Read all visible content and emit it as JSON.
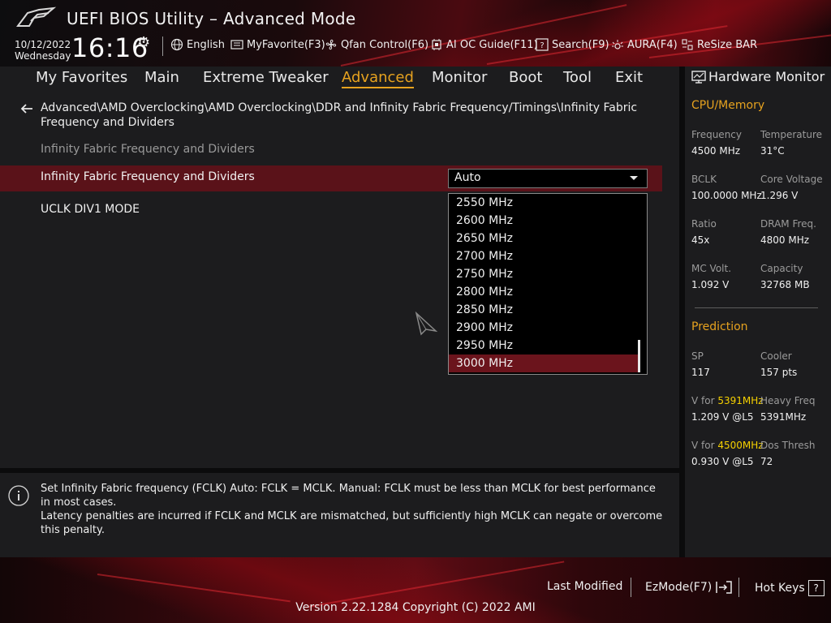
{
  "header": {
    "title": "UEFI BIOS Utility – Advanced Mode",
    "date": "10/12/2022",
    "weekday": "Wednesday",
    "time": "16:16",
    "items": [
      {
        "label": "English",
        "icon": "globe-icon"
      },
      {
        "label": "MyFavorite(F3)",
        "icon": "favorite-list-icon"
      },
      {
        "label": "Qfan Control(F6)",
        "icon": "fan-icon"
      },
      {
        "label": "AI OC Guide(F11)",
        "icon": "chip-icon"
      },
      {
        "label": "Search(F9)",
        "icon": "question-box-icon"
      },
      {
        "label": "AURA(F4)",
        "icon": "aura-light-icon"
      },
      {
        "label": "ReSize BAR",
        "icon": "resize-bar-icon"
      }
    ]
  },
  "nav": {
    "tabs": [
      "My Favorites",
      "Main",
      "Extreme Tweaker",
      "Advanced",
      "Monitor",
      "Boot",
      "Tool",
      "Exit"
    ],
    "active": "Advanced"
  },
  "main": {
    "breadcrumb": "Advanced\\AMD Overclocking\\AMD Overclocking\\DDR and Infinity Fabric Frequency/Timings\\Infinity Fabric Frequency and Dividers",
    "section_title": "Infinity Fabric Frequency and Dividers",
    "rows": [
      {
        "label": "Infinity Fabric Frequency and Dividers",
        "value": "Auto"
      },
      {
        "label": "UCLK DIV1 MODE"
      }
    ],
    "options": [
      "2550 MHz",
      "2600 MHz",
      "2650 MHz",
      "2700 MHz",
      "2750 MHz",
      "2800 MHz",
      "2850 MHz",
      "2900 MHz",
      "2950 MHz",
      "3000 MHz"
    ],
    "selected_option": "3000 MHz"
  },
  "help": {
    "line1": "Set Infinity Fabric frequency (FCLK) Auto: FCLK = MCLK. Manual: FCLK must be less than MCLK for best performance in most cases.",
    "line2": "Latency penalties are incurred if FCLK and MCLK are mismatched, but sufficiently high MCLK can negate or overcome this penalty."
  },
  "hwmon": {
    "title": "Hardware Monitor",
    "cpu_section": "CPU/Memory",
    "cpu": [
      {
        "label": "Frequency",
        "value": "4500 MHz"
      },
      {
        "label": "Temperature",
        "value": "31°C"
      },
      {
        "label": "BCLK",
        "value": "100.0000 MHz"
      },
      {
        "label": "Core Voltage",
        "value": "1.296 V"
      },
      {
        "label": "Ratio",
        "value": "45x"
      },
      {
        "label": "DRAM Freq.",
        "value": "4800 MHz"
      },
      {
        "label": "MC Volt.",
        "value": "1.092 V"
      },
      {
        "label": "Capacity",
        "value": "32768 MB"
      }
    ],
    "prediction_section": "Prediction",
    "prediction": {
      "sp_label": "SP",
      "sp_value": "117",
      "cooler_label": "Cooler",
      "cooler_value": "157 pts",
      "vfor1_prefix": "V for ",
      "vfor1_freq": "5391MHz",
      "vfor1_value": "1.209 V @L5",
      "heavy_label": "Heavy Freq",
      "heavy_value": "5391MHz",
      "vfor2_prefix": "V for ",
      "vfor2_freq": "4500MHz",
      "vfor2_value": "0.930 V @L5",
      "dos_label": "Dos Thresh",
      "dos_value": "72"
    }
  },
  "footer": {
    "last_modified": "Last Modified",
    "ezmode": "EzMode(F7)",
    "hotkeys": "Hot Keys",
    "hotkeys_box": "?",
    "version": "Version 2.22.1284 Copyright (C) 2022 AMI"
  },
  "colors": {
    "accent": "#e6a21f",
    "selection": "#5a1219",
    "highlight": "#f5d000"
  }
}
